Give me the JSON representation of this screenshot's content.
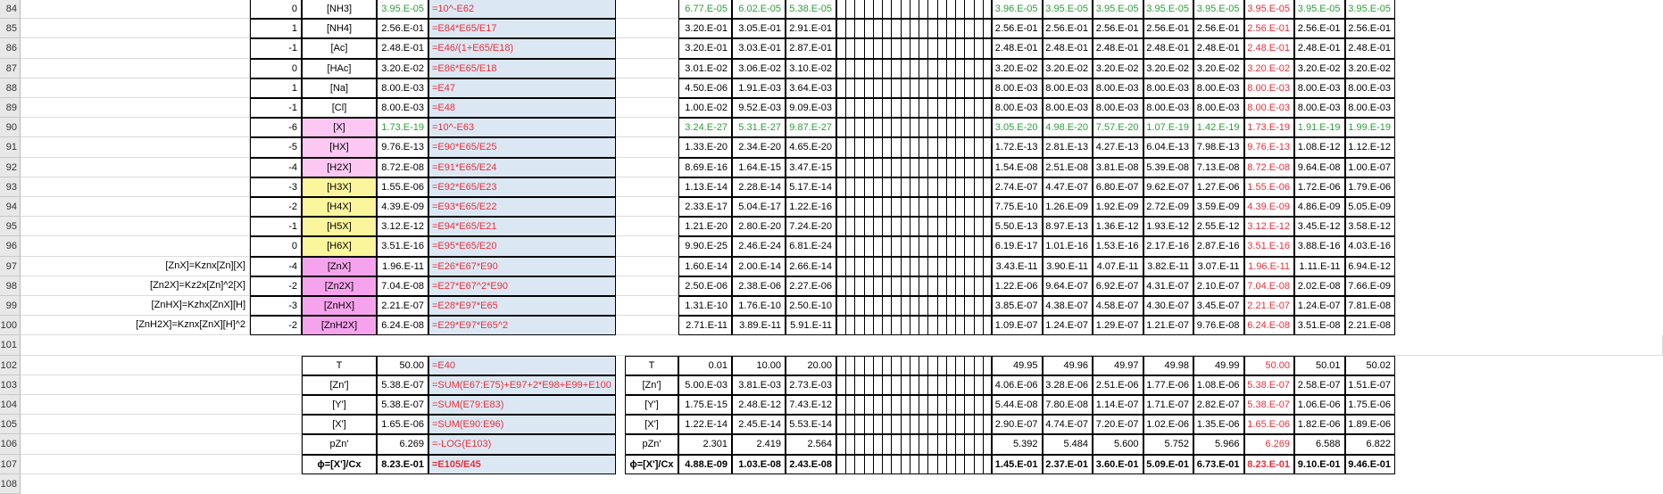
{
  "rows": [
    {
      "n": "84",
      "label": "",
      "idx": "0",
      "name": "[NH3]",
      "val": "3.95.E-05",
      "formula": "=10^-E62",
      "c1": "6.77.E-05",
      "c2": "6.02.E-05",
      "c3": "5.38.E-05",
      "r": [
        "3.96.E-05",
        "3.95.E-05",
        "3.95.E-05",
        "3.95.E-05",
        "3.95.E-05",
        "3.95.E-05",
        "3.95.E-05",
        "3.95.E-05"
      ],
      "color": "green",
      "bg": ""
    },
    {
      "n": "85",
      "label": "",
      "idx": "1",
      "name": "[NH4]",
      "val": "2.56.E-01",
      "formula": "=E84*E65/E17",
      "c1": "3.20.E-01",
      "c2": "3.05.E-01",
      "c3": "2.91.E-01",
      "r": [
        "2.56.E-01",
        "2.56.E-01",
        "2.56.E-01",
        "2.56.E-01",
        "2.56.E-01",
        "2.56.E-01",
        "2.56.E-01",
        "2.56.E-01"
      ],
      "color": "",
      "bg": ""
    },
    {
      "n": "86",
      "label": "",
      "idx": "-1",
      "name": "[Ac]",
      "val": "2.48.E-01",
      "formula": "=E46/(1+E65/E18)",
      "c1": "3.20.E-01",
      "c2": "3.03.E-01",
      "c3": "2.87.E-01",
      "r": [
        "2.48.E-01",
        "2.48.E-01",
        "2.48.E-01",
        "2.48.E-01",
        "2.48.E-01",
        "2.48.E-01",
        "2.48.E-01",
        "2.48.E-01"
      ],
      "color": "",
      "bg": ""
    },
    {
      "n": "87",
      "label": "",
      "idx": "0",
      "name": "[HAc]",
      "val": "3.20.E-02",
      "formula": "=E86*E65/E18",
      "c1": "3.01.E-02",
      "c2": "3.06.E-02",
      "c3": "3.10.E-02",
      "r": [
        "3.20.E-02",
        "3.20.E-02",
        "3.20.E-02",
        "3.20.E-02",
        "3.20.E-02",
        "3.20.E-02",
        "3.20.E-02",
        "3.20.E-02"
      ],
      "color": "",
      "bg": ""
    },
    {
      "n": "88",
      "label": "",
      "idx": "1",
      "name": "[Na]",
      "val": "8.00.E-03",
      "formula": "=E47",
      "c1": "4.50.E-06",
      "c2": "1.91.E-03",
      "c3": "3.64.E-03",
      "r": [
        "8.00.E-03",
        "8.00.E-03",
        "8.00.E-03",
        "8.00.E-03",
        "8.00.E-03",
        "8.00.E-03",
        "8.00.E-03",
        "8.00.E-03"
      ],
      "color": "",
      "bg": ""
    },
    {
      "n": "89",
      "label": "",
      "idx": "-1",
      "name": "[Cl]",
      "val": "8.00.E-03",
      "formula": "=E48",
      "c1": "1.00.E-02",
      "c2": "9.52.E-03",
      "c3": "9.09.E-03",
      "r": [
        "8.00.E-03",
        "8.00.E-03",
        "8.00.E-03",
        "8.00.E-03",
        "8.00.E-03",
        "8.00.E-03",
        "8.00.E-03",
        "8.00.E-03"
      ],
      "color": "",
      "bg": ""
    },
    {
      "n": "90",
      "label": "",
      "idx": "-6",
      "name": "[X]",
      "val": "1.73.E-19",
      "formula": "=10^-E63",
      "c1": "3.24.E-27",
      "c2": "5.31.E-27",
      "c3": "9.87.E-27",
      "r": [
        "3.05.E-20",
        "4.98.E-20",
        "7.57.E-20",
        "1.07.E-19",
        "1.42.E-19",
        "1.73.E-19",
        "1.91.E-19",
        "1.99.E-19"
      ],
      "color": "green",
      "bg": "pink"
    },
    {
      "n": "91",
      "label": "",
      "idx": "-5",
      "name": "[HX]",
      "val": "9.76.E-13",
      "formula": "=E90*E65/E25",
      "c1": "1.33.E-20",
      "c2": "2.34.E-20",
      "c3": "4.65.E-20",
      "r": [
        "1.72.E-13",
        "2.81.E-13",
        "4.27.E-13",
        "6.04.E-13",
        "7.98.E-13",
        "9.76.E-13",
        "1.08.E-12",
        "1.12.E-12"
      ],
      "color": "",
      "bg": "pink"
    },
    {
      "n": "92",
      "label": "",
      "idx": "-4",
      "name": "[H2X]",
      "val": "8.72.E-08",
      "formula": "=E91*E65/E24",
      "c1": "8.69.E-16",
      "c2": "1.64.E-15",
      "c3": "3.47.E-15",
      "r": [
        "1.54.E-08",
        "2.51.E-08",
        "3.81.E-08",
        "5.39.E-08",
        "7.13.E-08",
        "8.72.E-08",
        "9.64.E-08",
        "1.00.E-07"
      ],
      "color": "",
      "bg": "pink"
    },
    {
      "n": "93",
      "label": "",
      "idx": "-3",
      "name": "[H3X]",
      "val": "1.55.E-06",
      "formula": "=E92*E65/E23",
      "c1": "1.13.E-14",
      "c2": "2.28.E-14",
      "c3": "5.17.E-14",
      "r": [
        "2.74.E-07",
        "4.47.E-07",
        "6.80.E-07",
        "9.62.E-07",
        "1.27.E-06",
        "1.55.E-06",
        "1.72.E-06",
        "1.79.E-06"
      ],
      "color": "",
      "bg": "yellow"
    },
    {
      "n": "94",
      "label": "",
      "idx": "-2",
      "name": "[H4X]",
      "val": "4.39.E-09",
      "formula": "=E93*E65/E22",
      "c1": "2.33.E-17",
      "c2": "5.04.E-17",
      "c3": "1.22.E-16",
      "r": [
        "7.75.E-10",
        "1.26.E-09",
        "1.92.E-09",
        "2.72.E-09",
        "3.59.E-09",
        "4.39.E-09",
        "4.86.E-09",
        "5.05.E-09"
      ],
      "color": "",
      "bg": "yellow"
    },
    {
      "n": "95",
      "label": "",
      "idx": "-1",
      "name": "[H5X]",
      "val": "3.12.E-12",
      "formula": "=E94*E65/E21",
      "c1": "1.21.E-20",
      "c2": "2.80.E-20",
      "c3": "7.24.E-20",
      "r": [
        "5.50.E-13",
        "8.97.E-13",
        "1.36.E-12",
        "1.93.E-12",
        "2.55.E-12",
        "3.12.E-12",
        "3.45.E-12",
        "3.58.E-12"
      ],
      "color": "",
      "bg": "yellow"
    },
    {
      "n": "96",
      "label": "",
      "idx": "0",
      "name": "[H6X]",
      "val": "3.51.E-16",
      "formula": "=E95*E65/E20",
      "c1": "9.90.E-25",
      "c2": "2.46.E-24",
      "c3": "6.81.E-24",
      "r": [
        "6.19.E-17",
        "1.01.E-16",
        "1.53.E-16",
        "2.17.E-16",
        "2.87.E-16",
        "3.51.E-16",
        "3.88.E-16",
        "4.03.E-16"
      ],
      "color": "",
      "bg": "yellow"
    },
    {
      "n": "97",
      "label": "[ZnX]=Kznx[Zn][X]",
      "idx": "-4",
      "name": "[ZnX]",
      "val": "1.96.E-11",
      "formula": "=E26*E67*E90",
      "c1": "1.60.E-14",
      "c2": "2.00.E-14",
      "c3": "2.66.E-14",
      "r": [
        "3.43.E-11",
        "3.90.E-11",
        "4.07.E-11",
        "3.82.E-11",
        "3.07.E-11",
        "1.96.E-11",
        "1.11.E-11",
        "6.94.E-12"
      ],
      "color": "",
      "bg": "magenta"
    },
    {
      "n": "98",
      "label": "[Zn2X]=Kz2x[Zn]^2[X]",
      "idx": "-2",
      "name": "[Zn2X]",
      "val": "7.04.E-08",
      "formula": "=E27*E67^2*E90",
      "c1": "2.50.E-06",
      "c2": "2.38.E-06",
      "c3": "2.27.E-06",
      "r": [
        "1.22.E-06",
        "9.64.E-07",
        "6.92.E-07",
        "4.31.E-07",
        "2.10.E-07",
        "7.04.E-08",
        "2.02.E-08",
        "7.66.E-09"
      ],
      "color": "",
      "bg": "magenta"
    },
    {
      "n": "99",
      "label": "[ZnHX]=Kzhx[ZnX][H]",
      "idx": "-3",
      "name": "[ZnHX]",
      "val": "2.21.E-07",
      "formula": "=E28*E97*E65",
      "c1": "1.31.E-10",
      "c2": "1.76.E-10",
      "c3": "2.50.E-10",
      "r": [
        "3.85.E-07",
        "4.38.E-07",
        "4.58.E-07",
        "4.30.E-07",
        "3.45.E-07",
        "2.21.E-07",
        "1.24.E-07",
        "7.81.E-08"
      ],
      "color": "",
      "bg": "magenta"
    },
    {
      "n": "100",
      "label": "[ZnH2X]=Kznx[ZnX][H]^2",
      "idx": "-2",
      "name": "[ZnH2X]",
      "val": "6.24.E-08",
      "formula": "=E29*E97*E65^2",
      "c1": "2.71.E-11",
      "c2": "3.89.E-11",
      "c3": "5.91.E-11",
      "r": [
        "1.09.E-07",
        "1.24.E-07",
        "1.29.E-07",
        "1.21.E-07",
        "9.76.E-08",
        "6.24.E-08",
        "3.51.E-08",
        "2.21.E-08"
      ],
      "color": "",
      "bg": "magenta"
    }
  ],
  "row101": "101",
  "summary": [
    {
      "n": "102",
      "name": "T",
      "val": "50.00",
      "formula": "=E40",
      "c1": "0.01",
      "c2": "10.00",
      "c3": "20.00",
      "r": [
        "49.95",
        "49.96",
        "49.97",
        "49.98",
        "49.99",
        "50.00",
        "50.01",
        "50.02"
      ],
      "bold": false
    },
    {
      "n": "103",
      "name": "[Zn']",
      "val": "5.38.E-07",
      "formula": "=SUM(E67:E75)+E97+2*E98+E99+E100",
      "c1": "5.00.E-03",
      "c2": "3.81.E-03",
      "c3": "2.73.E-03",
      "r": [
        "4.06.E-06",
        "3.28.E-06",
        "2.51.E-06",
        "1.77.E-06",
        "1.08.E-06",
        "5.38.E-07",
        "2.58.E-07",
        "1.51.E-07"
      ],
      "bold": false
    },
    {
      "n": "104",
      "name": "[Y']",
      "val": "5.38.E-07",
      "formula": "=SUM(E79:E83)",
      "c1": "1.75.E-15",
      "c2": "2.48.E-12",
      "c3": "7.43.E-12",
      "r": [
        "5.44.E-08",
        "7.80.E-08",
        "1.14.E-07",
        "1.71.E-07",
        "2.82.E-07",
        "5.38.E-07",
        "1.06.E-06",
        "1.75.E-06"
      ],
      "bold": false
    },
    {
      "n": "105",
      "name": "[X']",
      "val": "1.65.E-06",
      "formula": "=SUM(E90:E96)",
      "c1": "1.22.E-14",
      "c2": "2.45.E-14",
      "c3": "5.53.E-14",
      "r": [
        "2.90.E-07",
        "4.74.E-07",
        "7.20.E-07",
        "1.02.E-06",
        "1.35.E-06",
        "1.65.E-06",
        "1.82.E-06",
        "1.89.E-06"
      ],
      "bold": false
    },
    {
      "n": "106",
      "name": "pZn'",
      "val": "6.269",
      "formula": "=-LOG(E103)",
      "c1": "2.301",
      "c2": "2.419",
      "c3": "2.564",
      "r": [
        "5.392",
        "5.484",
        "5.600",
        "5.752",
        "5.966",
        "6.269",
        "6.588",
        "6.822"
      ],
      "bold": false
    },
    {
      "n": "107",
      "name": "ϕ=[X']/Cx",
      "val": "8.23.E-01",
      "formula": "=E105/E45",
      "c1": "4.88.E-09",
      "c2": "1.03.E-08",
      "c3": "2.43.E-08",
      "r": [
        "1.45.E-01",
        "2.37.E-01",
        "3.60.E-01",
        "5.09.E-01",
        "6.73.E-01",
        "8.23.E-01",
        "9.10.E-01",
        "9.46.E-01"
      ],
      "bold": true
    }
  ],
  "row108": "108",
  "colors": {
    "green": "#2e9e3c",
    "red": "#e8303a",
    "pink": "#fcc8f3",
    "magenta": "#f6a3ee",
    "yellow": "#fbf59c",
    "blue": "#dbe8f4"
  }
}
